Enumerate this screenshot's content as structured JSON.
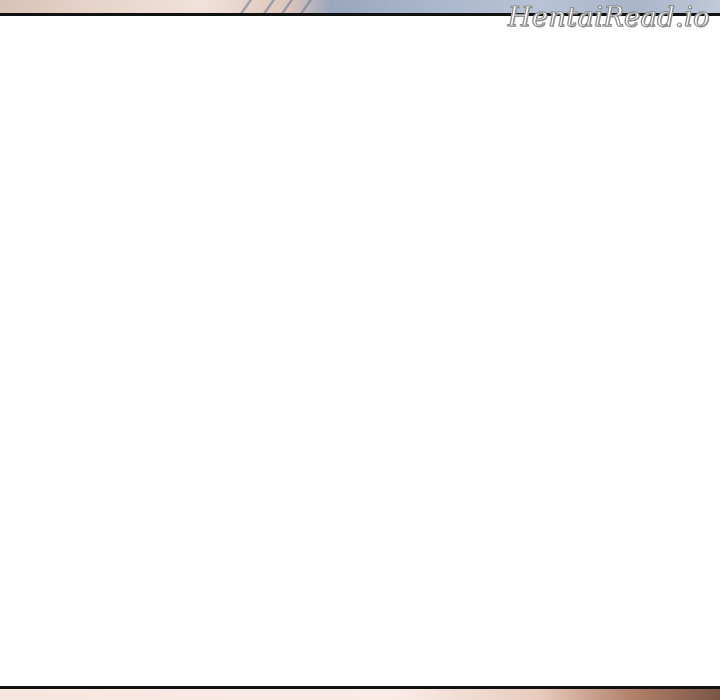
{
  "watermark": {
    "text": "HentaiRead.io"
  },
  "colors": {
    "panel_background": "#ffffff",
    "panel_border": "#111111",
    "top_strip_tones": [
      "#e6d2c8",
      "#aab6cc"
    ],
    "bottom_strip_tones": [
      "#f9ece7",
      "#7a5646"
    ]
  }
}
